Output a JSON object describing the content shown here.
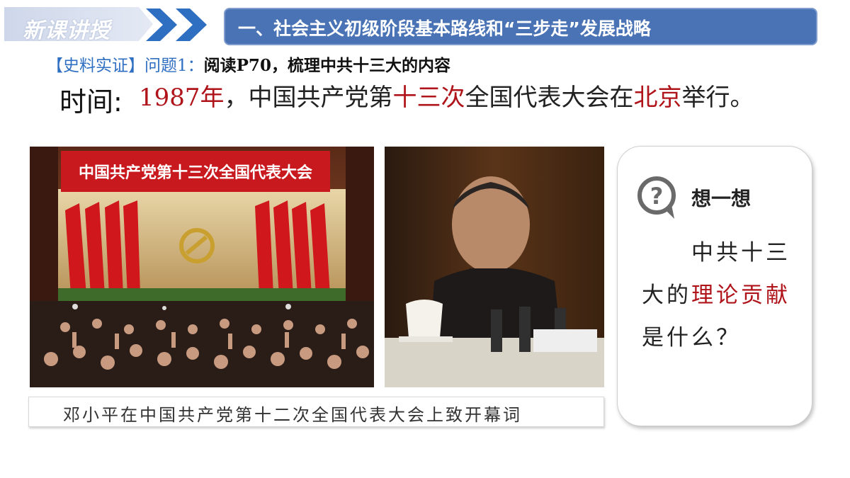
{
  "header": {
    "badge_label": "新课讲授",
    "title": "一、社会主义初级阶段基本路线和“三步走”发展战略"
  },
  "question": {
    "tag": "【史料实证】",
    "number": "问题1：",
    "text": "阅读P70，梳理中共十三大的内容"
  },
  "time": {
    "label": "时间:",
    "parts": [
      "1987年",
      "，中国共产党第",
      "十三次",
      "全国代表大会在",
      "北京",
      "举行。"
    ]
  },
  "photo_left": {
    "banner_text": "中国共产党第十三次全国代表大会"
  },
  "caption": {
    "text": "邓小平在中国共产党第十二次全国代表大会上致开幕词"
  },
  "think": {
    "title": "想一想",
    "line1": "中共十三",
    "line2_a": "大的",
    "line2_b": "理论贡献",
    "line3": "是什么？"
  },
  "colors": {
    "accent_blue": "#4a73b5",
    "question_blue": "#2f6fc2",
    "highlight_red": "#b0141b"
  }
}
